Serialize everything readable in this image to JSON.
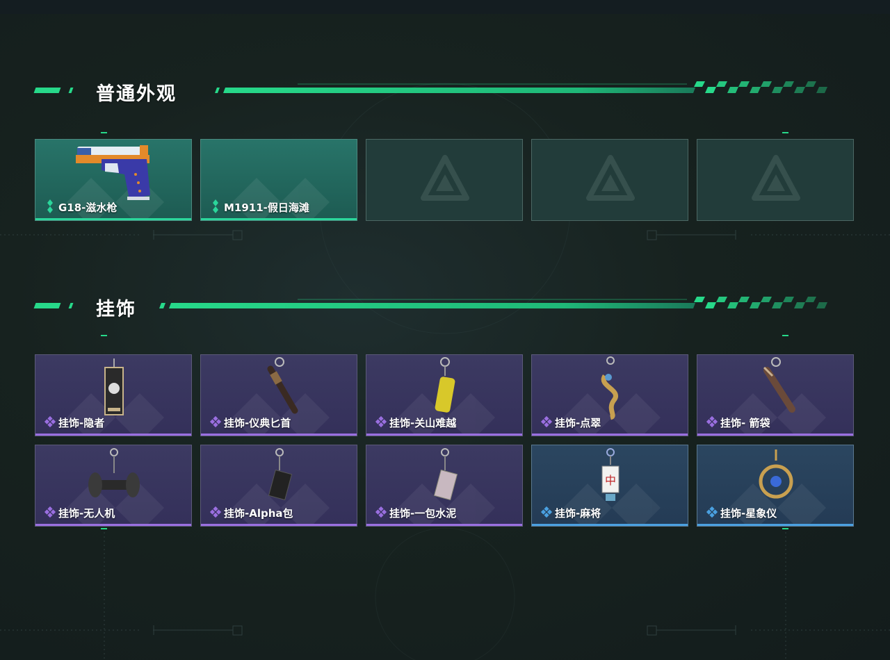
{
  "sections": {
    "skins": {
      "title": "普通外观",
      "items": [
        {
          "name": "G18-滋水枪",
          "rarity": "green"
        },
        {
          "name": "M1911-假日海滩",
          "rarity": "green"
        },
        {
          "name": "",
          "rarity": "empty"
        },
        {
          "name": "",
          "rarity": "empty"
        },
        {
          "name": "",
          "rarity": "empty"
        }
      ]
    },
    "charms": {
      "title": "挂饰",
      "items": [
        {
          "name": "挂饰-隐者",
          "rarity": "purple",
          "icon": "tarot-card-charm-icon"
        },
        {
          "name": "挂饰-仪典匕首",
          "rarity": "purple",
          "icon": "dagger-charm-icon"
        },
        {
          "name": "挂饰-关山难越",
          "rarity": "purple",
          "icon": "yellow-can-charm-icon"
        },
        {
          "name": "挂饰-点翠",
          "rarity": "purple",
          "icon": "phoenix-charm-icon"
        },
        {
          "name": "挂饰- 箭袋",
          "rarity": "purple",
          "icon": "quiver-charm-icon"
        },
        {
          "name": "挂饰-无人机",
          "rarity": "purple",
          "icon": "drone-charm-icon"
        },
        {
          "name": "挂饰-Alpha包",
          "rarity": "purple",
          "icon": "alpha-bag-charm-icon"
        },
        {
          "name": "挂饰-一包水泥",
          "rarity": "purple",
          "icon": "cement-bag-charm-icon"
        },
        {
          "name": "挂饰-麻将",
          "rarity": "blue",
          "icon": "mahjong-charm-icon"
        },
        {
          "name": "挂饰-星象仪",
          "rarity": "blue",
          "icon": "astrolabe-charm-icon"
        }
      ]
    }
  },
  "colors": {
    "accent_green": "#27d98a",
    "rarity_green": "#2bd69b",
    "rarity_purple": "#9a6fe0",
    "rarity_blue": "#4aa0e0"
  }
}
